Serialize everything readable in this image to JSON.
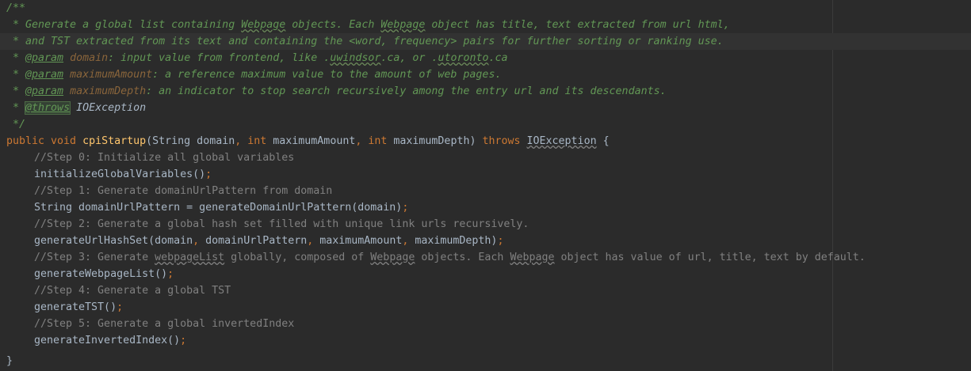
{
  "javadoc": {
    "open": "/**",
    "l1_a": " * Generate a global list containing ",
    "l1_b": "Webpage",
    "l1_c": " objects. Each ",
    "l1_d": "Webpage",
    "l1_e": " object has title, text extracted from url html,",
    "l2": " * and TST extracted from its text and containing the <word, frequency> pairs for further sorting or ranking use.",
    "l3_star": " * ",
    "l3_tag": "@param",
    "l3_name": " domain",
    "l3_a": ": input value from frontend, like .",
    "l3_b": "uwindsor",
    "l3_c": ".ca, or .",
    "l3_d": "utoronto",
    "l3_e": ".ca",
    "l4_star": " * ",
    "l4_tag": "@param",
    "l4_name": " maximumAmount",
    "l4_desc": ": a reference maximum value to the amount of web pages.",
    "l5_star": " * ",
    "l5_tag": "@param",
    "l5_name": " maximumDepth",
    "l5_desc": ": an indicator to stop search recursively among the entry url and its descendants.",
    "l6_star": " * ",
    "l6_tag": "@throws",
    "l6_desc": " IOException",
    "close": " */"
  },
  "signature": {
    "mods": "public void ",
    "name": "cpiStartup",
    "p_open": "(String domain",
    "c1": ", ",
    "int1": "int ",
    "p2": "maximumAmount",
    "c2": ", ",
    "int2": "int ",
    "p3": "maximumDepth) ",
    "throws": "throws ",
    "exc": "IOException",
    "brace": " {"
  },
  "body": {
    "c0": "//Step 0: Initialize all global variables",
    "s0_call": "initializeGlobalVariables()",
    "s0_semi": ";",
    "c1": "//Step 1: Generate domainUrlPattern from domain",
    "s1_call": "String domainUrlPattern = generateDomainUrlPattern(domain)",
    "s1_semi": ";",
    "c2": "//Step 2: Generate a global hash set filled with unique link urls recursively.",
    "s2_a": "generateUrlHashSet(domain",
    "s2_c1": ", ",
    "s2_b": "domainUrlPattern",
    "s2_c2": ", ",
    "s2_c": "maximumAmount",
    "s2_c3": ", ",
    "s2_d": "maximumDepth)",
    "s2_semi": ";",
    "c3_a": "//Step 3: Generate ",
    "c3_b": "webpageList",
    "c3_c": " globally, composed of ",
    "c3_d": "Webpage",
    "c3_e": " objects. Each ",
    "c3_f": "Webpage",
    "c3_g": " object has value of url, title, text by default.",
    "s3_call": "generateWebpageList()",
    "s3_semi": ";",
    "c4": "//Step 4: Generate a global TST",
    "s4_call": "generateTST()",
    "s4_semi": ";",
    "c5": "//Step 5: Generate a global invertedIndex",
    "s5_call": "generateInvertedIndex()",
    "s5_semi": ";",
    "end": "}"
  },
  "colors": {
    "background": "#2b2b2b",
    "comment_doc": "#629755",
    "keyword": "#cc7832",
    "line_comment": "#808080",
    "default_text": "#a9b7c6"
  }
}
